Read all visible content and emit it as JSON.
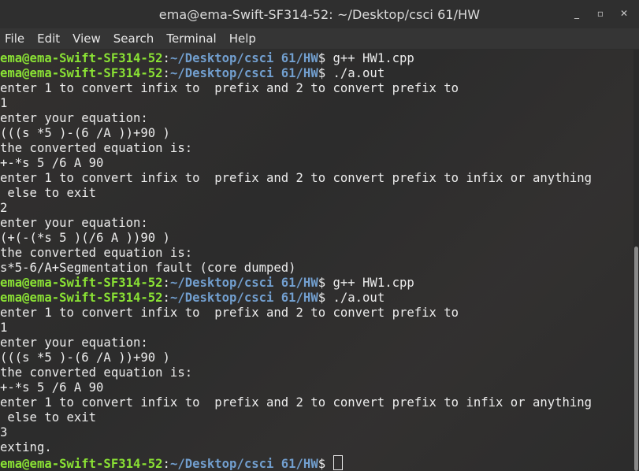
{
  "window": {
    "title": "ema@ema-Swift-SF314-52: ~/Desktop/csci 61/HW",
    "controls": {
      "minimize": "_",
      "maximize": "▫",
      "close": "✕"
    }
  },
  "menubar": {
    "items": [
      "File",
      "Edit",
      "View",
      "Search",
      "Terminal",
      "Help"
    ]
  },
  "prompt": {
    "user": "ema@ema-Swift-SF314-52",
    "sep": ":",
    "path": "~/Desktop/csci 61/HW",
    "sym": "$ "
  },
  "terminal": {
    "lines": [
      {
        "type": "prompt",
        "cmd": "g++ HW1.cpp"
      },
      {
        "type": "prompt",
        "cmd": "./a.out"
      },
      {
        "type": "text",
        "text": "enter 1 to convert infix to  prefix and 2 to convert prefix to"
      },
      {
        "type": "text",
        "text": "1"
      },
      {
        "type": "text",
        "text": "enter your equation:"
      },
      {
        "type": "text",
        "text": "(((s *5 )-(6 /A ))+90 )"
      },
      {
        "type": "text",
        "text": "the converted equation is:"
      },
      {
        "type": "text",
        "text": "+-*s 5 /6 A 90"
      },
      {
        "type": "text",
        "text": "enter 1 to convert infix to  prefix and 2 to convert prefix to infix or anything"
      },
      {
        "type": "text",
        "text": " else to exit"
      },
      {
        "type": "text",
        "text": "2"
      },
      {
        "type": "text",
        "text": "enter your equation:"
      },
      {
        "type": "text",
        "text": "(+(-(*s 5 )(/6 A ))90 )"
      },
      {
        "type": "text",
        "text": "the converted equation is:"
      },
      {
        "type": "text",
        "text": "s*5-6/A+Segmentation fault (core dumped)"
      },
      {
        "type": "prompt",
        "cmd": "g++ HW1.cpp"
      },
      {
        "type": "prompt",
        "cmd": "./a.out"
      },
      {
        "type": "text",
        "text": "enter 1 to convert infix to  prefix and 2 to convert prefix to"
      },
      {
        "type": "text",
        "text": "1"
      },
      {
        "type": "text",
        "text": "enter your equation:"
      },
      {
        "type": "text",
        "text": "(((s *5 )-(6 /A ))+90 )"
      },
      {
        "type": "text",
        "text": "the converted equation is:"
      },
      {
        "type": "text",
        "text": "+-*s 5 /6 A 90"
      },
      {
        "type": "text",
        "text": "enter 1 to convert infix to  prefix and 2 to convert prefix to infix or anything"
      },
      {
        "type": "text",
        "text": " else to exit"
      },
      {
        "type": "text",
        "text": "3"
      },
      {
        "type": "text",
        "text": "exting."
      },
      {
        "type": "prompt",
        "cmd": ""
      }
    ]
  },
  "colors": {
    "user": "#8ae234",
    "path": "#729fcf",
    "text": "#ececec",
    "background": "#2c2c2c"
  }
}
